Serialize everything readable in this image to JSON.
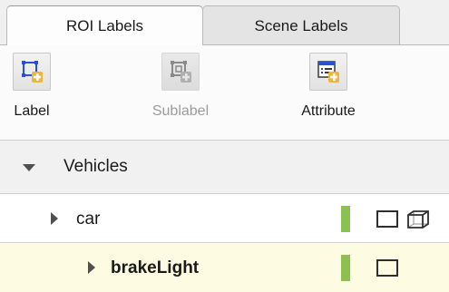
{
  "tabs": [
    {
      "label": "ROI Labels",
      "active": true
    },
    {
      "label": "Scene Labels",
      "active": false
    }
  ],
  "toolbar": {
    "label": {
      "text": "Label",
      "icon": "add-roi-label-icon"
    },
    "sublabel": {
      "text": "Sublabel",
      "icon": "add-sublabel-icon",
      "disabled": true
    },
    "attribute": {
      "text": "Attribute",
      "icon": "add-attribute-icon"
    }
  },
  "tree": {
    "group": {
      "name": "Vehicles",
      "expanded": true
    },
    "items": [
      {
        "name": "car",
        "color": "#8cc152",
        "shape": "rectangle",
        "has_cuboid": true
      },
      {
        "name": "brakeLight",
        "color": "#8cc152",
        "shape": "rectangle",
        "selected": true
      }
    ]
  },
  "colors": {
    "accent_icon": "#2a4fd4",
    "plus_badge": "#f2b33d",
    "label_color": "#8cc152",
    "selected_row": "#fdfbe1"
  }
}
